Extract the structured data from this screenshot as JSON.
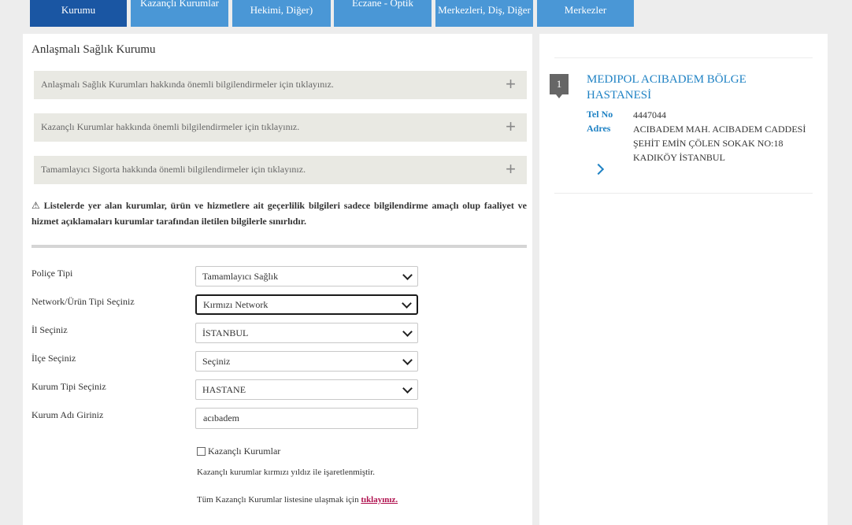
{
  "tabs": [
    {
      "label": "Kurumu",
      "active": true
    },
    {
      "label": "Kazançlı Kurumlar",
      "active": false
    },
    {
      "label": "Hekimi, Diğer)",
      "active": false
    },
    {
      "label": "Eczane - Optik",
      "active": false
    },
    {
      "label": "Merkezleri, Diş, Diğer",
      "active": false
    },
    {
      "label": "Merkezler",
      "active": false
    }
  ],
  "main": {
    "title": "Anlaşmalı Sağlık Kurumu",
    "accordions": [
      {
        "label": "Anlaşmalı Sağlık Kurumları hakkında önemli bilgilendirmeler için tıklayınız.",
        "icon": "+"
      },
      {
        "label": "Kazançlı Kurumlar hakkında önemli bilgilendirmeler için tıklayınız.",
        "icon": "+"
      },
      {
        "label": "Tamamlayıcı Sigorta hakkında önemli bilgilendirmeler için tıklayınız.",
        "icon": "+"
      }
    ],
    "notice_icon": "⚠",
    "notice": "Listelerde yer alan kurumlar, ürün ve hizmetlere ait geçerlilik bilgileri sadece bilgilendirme amaçlı olup faaliyet ve hizmet açıklamaları kurumlar tarafından iletilen bilgilerle sınırlıdır."
  },
  "form": {
    "policy_type": {
      "label": "Poliçe Tipi",
      "value": "Tamamlayıcı Sağlık"
    },
    "network": {
      "label": "Network/Ürün Tipi Seçiniz",
      "value": "Kırmızı Network"
    },
    "city": {
      "label": "İl Seçiniz",
      "value": "İSTANBUL"
    },
    "district": {
      "label": "İlçe Seçiniz",
      "value": "Seçiniz"
    },
    "institution_type": {
      "label": "Kurum Tipi Seçiniz",
      "value": "HASTANE"
    },
    "institution_name": {
      "label": "Kurum Adı Giriniz",
      "value": "acıbadem"
    },
    "checkbox_label": "Kazançlı Kurumlar",
    "star_note": "Kazançlı kurumlar kırmızı yıldız ile işaretlenmiştir.",
    "list_link_text": "Tüm Kazançlı Kurumlar listesine ulaşmak için",
    "list_link_label": "tıklayınız."
  },
  "results": [
    {
      "index": "1",
      "name": "MEDIPOL ACIBADEM BÖLGE HASTANESİ",
      "tel_label": "Tel No",
      "tel": "4447044",
      "address_label": "Adres",
      "address": "ACIBADEM MAH. ACIBADEM CADDESİ ŞEHİT EMİN ÇÖLEN SOKAK NO:18 KADIKÖY İSTANBUL"
    }
  ],
  "colors": {
    "tab_active": "#1a56a3",
    "tab": "#4a97d6",
    "link_blue": "#1f82c4",
    "link_magenta": "#b0124f",
    "accordion_bg": "#e9e9e3"
  }
}
